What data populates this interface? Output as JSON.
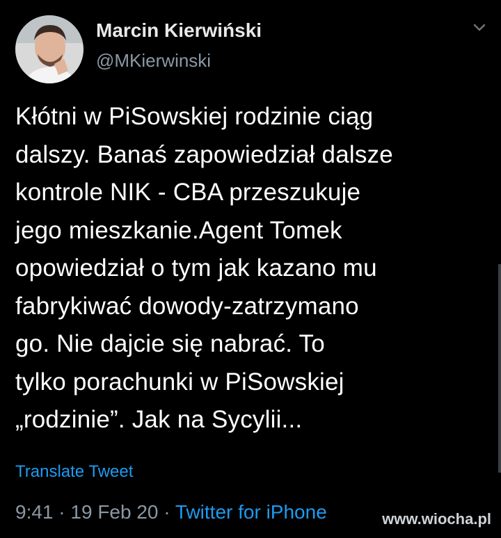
{
  "tweet": {
    "author": {
      "display_name": "Marcin Kierwiński",
      "handle": "@MKierwinski"
    },
    "text": "Kłótni w PiSowskiej rodzinie ciąg\ndalszy. Banaś zapowiedział dalsze\nkontrole NIK - CBA przeszukuje\njego mieszkanie.Agent Tomek\nopowiedział o tym jak kazano mu\nfabrykiwać dowody-zatrzymano\ngo. Nie dajcie się nabrać. To\ntylko porachunki w PiSowskiej\n„rodzinie”. Jak na Sycylii...",
    "translate_label": "Translate Tweet",
    "time": "9:41",
    "separator": " · ",
    "date": "19 Feb 20",
    "source": "Twitter for iPhone"
  },
  "watermark": "www.wiocha.pl",
  "icons": {
    "menu": "chevron-down-icon"
  },
  "colors": {
    "background": "#000000",
    "text": "#ffffff",
    "secondary": "#8b98a5",
    "link": "#1d9bf0"
  }
}
